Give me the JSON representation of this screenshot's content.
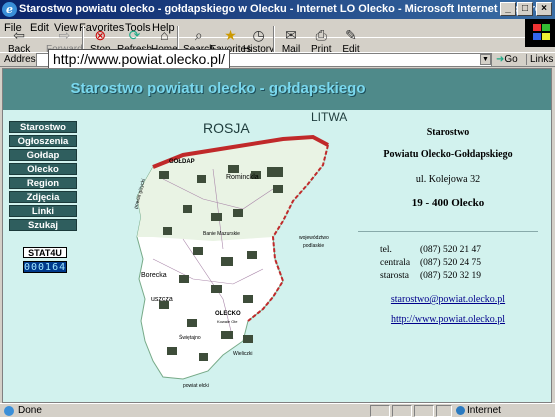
{
  "window": {
    "title": "Starostwo powiatu olecko - gołdapskiego w Olecku - Internet LO Olecko - Microsoft Internet Explorer",
    "min_label": "_",
    "max_label": "□",
    "close_label": "×"
  },
  "menu": [
    "File",
    "Edit",
    "View",
    "Favorites",
    "Tools",
    "Help"
  ],
  "toolbar": {
    "back": "Back",
    "forward": "Forward",
    "stop": "Stop",
    "refresh": "Refresh",
    "home": "Home",
    "search": "Search",
    "favorites": "Favorites",
    "history": "History",
    "mail": "Mail",
    "print": "Print",
    "edit": "Edit"
  },
  "address": {
    "label": "Address",
    "url": "http://www.powiat.olecko.pl/",
    "go": "Go",
    "links": "Links"
  },
  "page": {
    "banner_title": "Starostwo powiatu olecko - gołdapskiego",
    "nav": [
      "Starostwo",
      "Ogłoszenia",
      "Gołdap",
      "Olecko",
      "Region",
      "Zdjęcia",
      "Linki",
      "Szukaj"
    ],
    "stat_label": "STAT4U",
    "stat_count": "000164",
    "map_labels": {
      "rosja": "ROSJA",
      "litwa": "LITWA",
      "goldap": "GOŁDAP",
      "olecko": "OLECKO",
      "rominckla": "Rominckla",
      "banie": "Banie Mazurskie",
      "wojewodztwo": "województwo",
      "podlaskie": "podlaskie",
      "powiat_gizycki": "powiat giżycki",
      "powiat_elcki": "powiat ełcki",
      "borecka": "Borecka",
      "puszcza": "uszcza",
      "kowale": "Kowale Ole",
      "swietajno": "Świętajno",
      "wieliczki": "Wieliczki"
    },
    "info": {
      "org_line1": "Starostwo",
      "org_line2": "Powiatu Olecko-Gołdapskiego",
      "street": "ul. Kolejowa 32",
      "postal": "19 - 400 Olecko",
      "contacts": [
        {
          "label": "tel.",
          "value": "(087) 520 21 47"
        },
        {
          "label": "centrala",
          "value": "(087) 520 24 75"
        },
        {
          "label": "starosta",
          "value": "(087) 520 32 19"
        }
      ],
      "email": "starostwo@powiat.olecko.pl",
      "website": "http://www.powiat.olecko.pl"
    }
  },
  "status": {
    "text": "Done",
    "zone": "Internet"
  },
  "colors": {
    "banner": "#4f8a8a",
    "page_bg": "#d2f2ee",
    "nav_bg": "#2f5e5e",
    "map_land": "#ffffff",
    "map_border": "#c0292a"
  }
}
